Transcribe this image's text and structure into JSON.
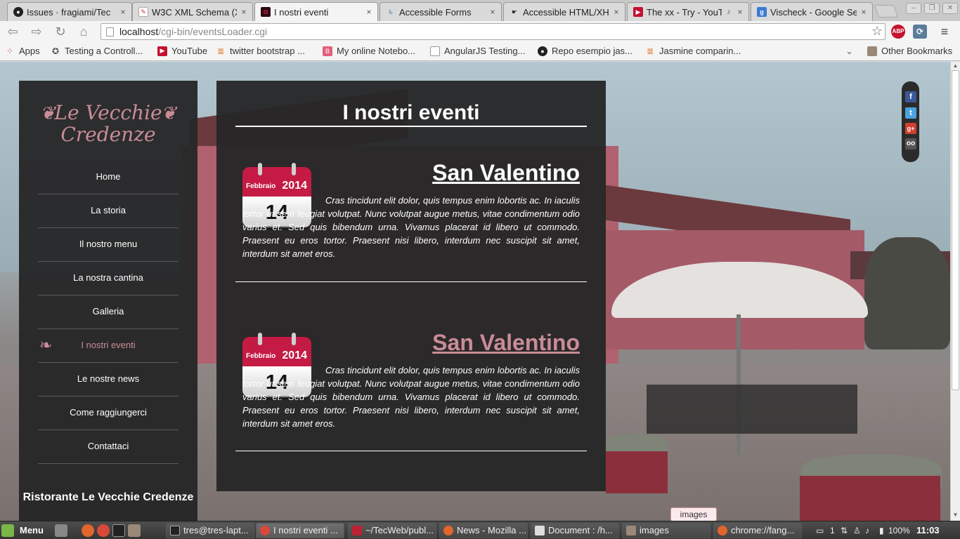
{
  "browser": {
    "tabs": [
      {
        "title": "Issues · fragiami/Tec",
        "icon": "github-icon",
        "active": false
      },
      {
        "title": "W3C XML Schema (X",
        "icon": "w3c-icon",
        "active": false
      },
      {
        "title": "I nostri eventi",
        "icon": "page-icon",
        "active": true
      },
      {
        "title": "Accessible Forms",
        "icon": "accessible-icon",
        "active": false
      },
      {
        "title": "Accessible HTML/XHT",
        "icon": "hand-icon",
        "active": false
      },
      {
        "title": "The xx - Try - YouT",
        "icon": "youtube-icon",
        "active": false
      },
      {
        "title": "Vischeck - Google Se",
        "icon": "google-icon",
        "active": false
      }
    ],
    "close_glyph": "×",
    "url_host": "localhost",
    "url_path": "/cgi-bin/eventsLoader.cgi",
    "extension_abp": "ABP",
    "bookmarks": [
      {
        "label": "Apps",
        "icon": "apps-icon"
      },
      {
        "label": "Testing a Controll...",
        "icon": "bookmark-site-icon"
      },
      {
        "label": "YouTube",
        "icon": "youtube-icon"
      },
      {
        "label": "twitter bootstrap ...",
        "icon": "stackoverflow-icon"
      },
      {
        "label": "My online Notebo...",
        "icon": "blogger-icon"
      },
      {
        "label": "AngularJS Testing...",
        "icon": "page-icon"
      },
      {
        "label": "Repo esempio jas...",
        "icon": "github-icon"
      },
      {
        "label": "Jasmine comparin...",
        "icon": "stackoverflow-icon"
      }
    ],
    "other_bookmarks": "Other Bookmarks"
  },
  "site": {
    "logo_line1": "Le Vecchie",
    "logo_line2": "Credenze",
    "nav": [
      {
        "label": "Home",
        "active": false
      },
      {
        "label": "La storia",
        "active": false
      },
      {
        "label": "Il nostro menu",
        "active": false
      },
      {
        "label": "La nostra cantina",
        "active": false
      },
      {
        "label": "Galleria",
        "active": false
      },
      {
        "label": "I nostri eventi",
        "active": true
      },
      {
        "label": "Le nostre news",
        "active": false
      },
      {
        "label": "Come raggiungerci",
        "active": false
      },
      {
        "label": "Contattaci",
        "active": false
      }
    ],
    "footer_name": "Ristorante Le Vecchie Credenze",
    "page_title": "I nostri eventi",
    "events": [
      {
        "title": "San Valentino",
        "visited": false,
        "month": "Febbraio",
        "year": "2014",
        "day": "14",
        "description": "Cras tincidunt elit dolor, quis tempus enim lobortis ac. In iaculis tortor ut sem feugiat volutpat. Nunc volutpat augue metus, vitae condimentum odio varius et. Sed quis bibendum urna. Vivamus placerat id libero ut commodo. Praesent eu eros tortor. Praesent nisi libero, interdum nec suscipit sit amet, interdum sit amet eros."
      },
      {
        "title": "San Valentino",
        "visited": true,
        "month": "Febbraio",
        "year": "2014",
        "day": "14",
        "description": "Cras tincidunt elit dolor, quis tempus enim lobortis ac. In iaculis tortor ut sem feugiat volutpat. Nunc volutpat augue metus, vitae condimentum odio varius et. Sed quis bibendum urna. Vivamus placerat id libero ut commodo. Praesent eu eros tortor. Praesent nisi libero, interdum nec suscipit sit amet, interdum sit amet eros."
      }
    ],
    "social": [
      "facebook-icon",
      "twitter-icon",
      "google-plus-icon",
      "tripadvisor-icon"
    ],
    "colors": {
      "accent": "#c98c96",
      "calendar_red": "#c41a44",
      "panel": "#262628"
    }
  },
  "download_bubble": "images",
  "taskbar": {
    "menu_label": "Menu",
    "tasks": [
      {
        "label": "tres@tres-lapt...",
        "icon": "terminal-icon",
        "active": false
      },
      {
        "label": "I nostri eventi ...",
        "icon": "chrome-icon",
        "active": true
      },
      {
        "label": "~/TecWeb/publ...",
        "icon": "editor-icon",
        "active": false
      },
      {
        "label": "News - Mozilla ...",
        "icon": "firefox-icon",
        "active": false
      },
      {
        "label": "Document : /h...",
        "icon": "document-icon",
        "active": false
      },
      {
        "label": "images",
        "icon": "folder-icon",
        "active": false
      },
      {
        "label": "chrome://fang...",
        "icon": "firefox-icon",
        "active": false
      }
    ],
    "tray_count": "1",
    "battery": "100%",
    "clock": "11:03"
  }
}
